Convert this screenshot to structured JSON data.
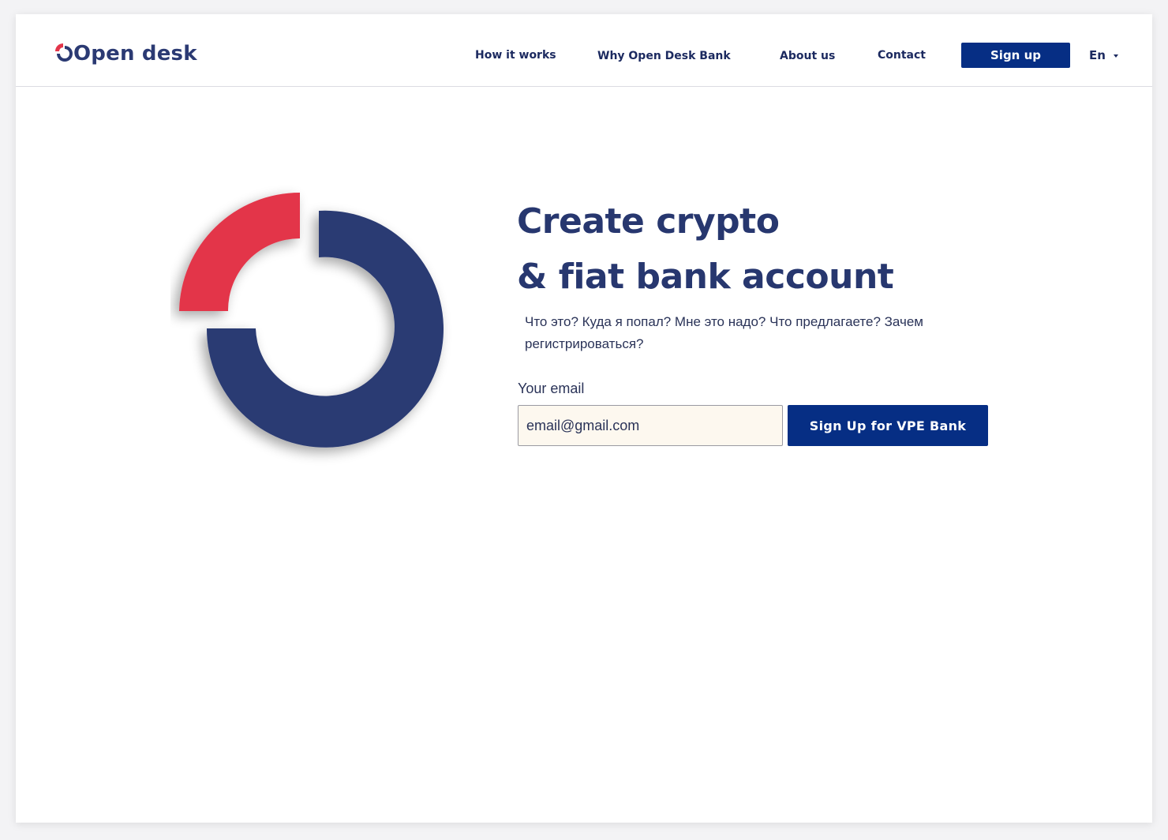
{
  "brand": {
    "name": "Open desk",
    "colors": {
      "navy": "#2b3a73",
      "red": "#e3354a",
      "button": "#062e84"
    }
  },
  "nav": {
    "items": [
      {
        "label": "How it works"
      },
      {
        "label": "Why Open Desk Bank"
      },
      {
        "label": "About us"
      },
      {
        "label": "Contact"
      }
    ],
    "signup_label": "Sign up",
    "language": "En"
  },
  "hero": {
    "title_line1": "Create crypto",
    "title_line2": "& fiat bank account",
    "description": "Что это? Куда я попал? Мне это надо? Что предлагаете? Зачем регистрироваться?",
    "email_label": "Your email",
    "email_value": "email@gmail.com",
    "cta_label": "Sign Up for VPE Bank"
  },
  "icons": {
    "logo": "open-desk-logo-icon",
    "language_caret": "chevron-down-icon",
    "hero": "ring-graphic"
  }
}
